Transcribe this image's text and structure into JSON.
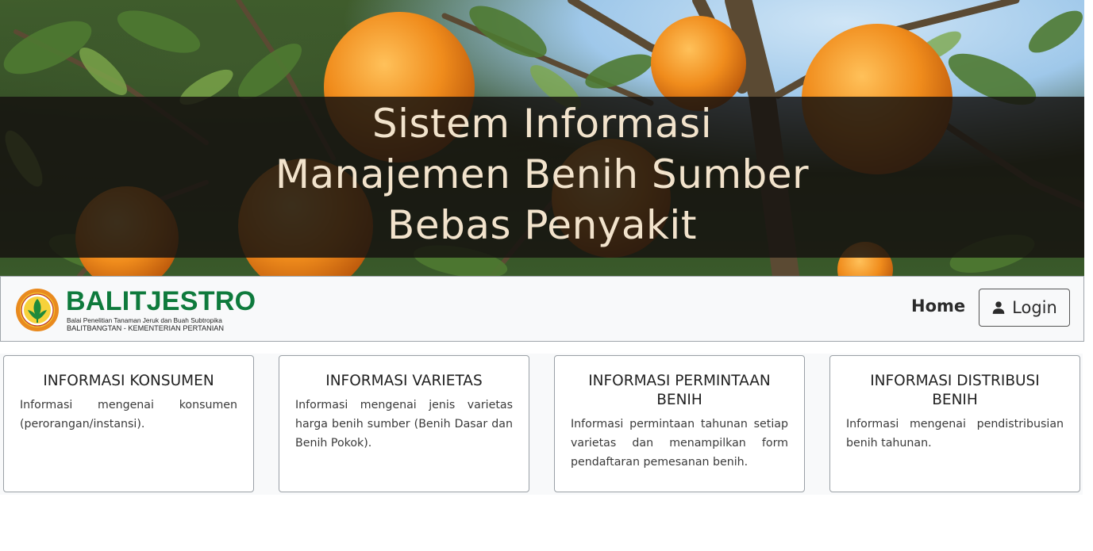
{
  "hero": {
    "title_lines": [
      "Sistem Informasi",
      "Manajemen Benih Sumber",
      "Bebas Penyakit"
    ]
  },
  "navbar": {
    "logo": {
      "name": "BALITJESTRO",
      "subtitle1": "Balai Penelitian Tanaman Jeruk dan Buah Subtropika",
      "subtitle2": "BALITBANGTAN - KEMENTERIAN PERTANIAN"
    },
    "home_label": "Home",
    "login_label": "Login",
    "login_icon": "user-icon"
  },
  "cards": [
    {
      "title": "INFORMASI KONSUMEN",
      "text": "Informasi mengenai konsumen (perorangan/instansi)."
    },
    {
      "title": "INFORMASI VARIETAS",
      "text": "Informasi mengenai jenis varietas harga benih sumber (Benih Dasar dan Benih Pokok)."
    },
    {
      "title": "INFORMASI PERMINTAAN BENIH",
      "text": "Informasi permintaan tahunan setiap varietas dan menampilkan form pendaftaran pemesanan benih."
    },
    {
      "title": "INFORMASI DISTRIBUSI BENIH",
      "text": "Informasi mengenai pendistribusian benih tahunan."
    }
  ],
  "colors": {
    "logo_green": "#0e7a3c",
    "orange": "#e98a1e",
    "navbar_bg": "#f8f9fa"
  }
}
